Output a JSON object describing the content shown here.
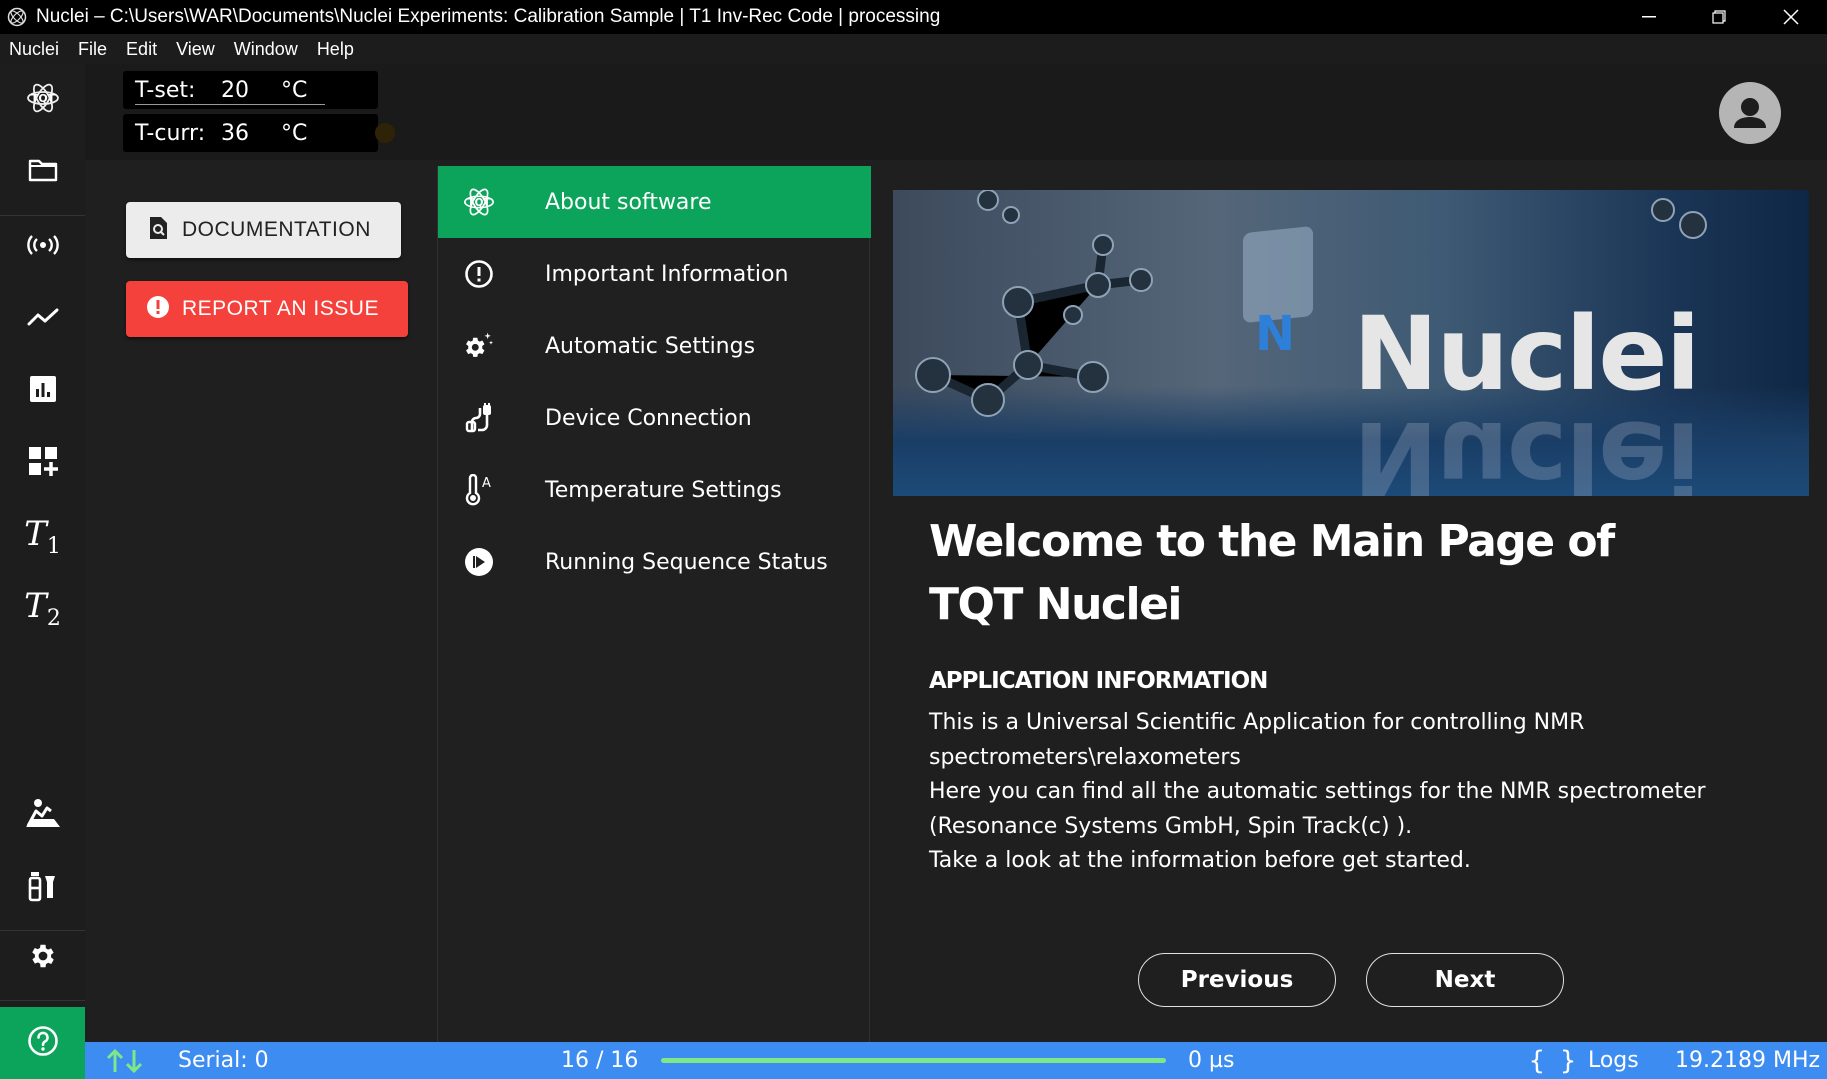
{
  "window": {
    "title": "Nuclei – C:\\Users\\WAR\\Documents\\Nuclei Experiments: Calibration Sample | T1 Inv-Rec Code | processing"
  },
  "menu": [
    "Nuclei",
    "File",
    "Edit",
    "View",
    "Window",
    "Help"
  ],
  "rail": {
    "items": [
      "tqt-logo-icon",
      "folder-icon",
      "signal-icon",
      "trend-icon",
      "bar-chart-icon",
      "add-widget-icon",
      "t1-icon",
      "t2-icon",
      "sample-icon",
      "lab-icon",
      "gear-icon",
      "cart-icon",
      "help-icon"
    ],
    "t1_symbol": "T",
    "t1_sub": "1",
    "t2_symbol": "T",
    "t2_sub": "2"
  },
  "header": {
    "t_set": {
      "label": "T-set:",
      "value": "20",
      "unit": "°C"
    },
    "t_curr": {
      "label": "T-curr:",
      "value": "36",
      "unit": "°C"
    }
  },
  "actions": {
    "documentation": "DOCUMENTATION",
    "report": "REPORT AN ISSUE"
  },
  "nav": {
    "items": [
      {
        "label": "About software",
        "icon": "tqt-logo-icon",
        "active": true
      },
      {
        "label": "Important Information",
        "icon": "alert-circle-icon",
        "active": false
      },
      {
        "label": "Automatic Settings",
        "icon": "auto-settings-icon",
        "active": false
      },
      {
        "label": "Device Connection",
        "icon": "plug-icon",
        "active": false
      },
      {
        "label": "Temperature Settings",
        "icon": "thermometer-icon",
        "active": false
      },
      {
        "label": "Running Sequence Status",
        "icon": "play-circle-icon",
        "active": false
      }
    ]
  },
  "content": {
    "hero_brand": "Nuclei",
    "welcome": "Welcome to the Main Page of TQT Nuclei",
    "app_info_heading": "APPLICATION INFORMATION",
    "app_info_lines": [
      "This is a Universal Scientific Application for controlling NMR",
      "spectrometers\\relaxometers",
      "Here you can find all the automatic settings for the NMR spectrometer",
      "(Resonance Systems GmbH, Spin Track(c) ).",
      "Take a look at the information before get started."
    ],
    "previous": "Previous",
    "next": "Next"
  },
  "status": {
    "serial": "Serial: 0",
    "progress_text": "16 / 16",
    "progress_fraction": 1.0,
    "time": "0 µs",
    "logs": "Logs",
    "frequency": "19.2189 MHz"
  },
  "colors": {
    "accent_green": "#0ca35a",
    "report_red": "#f5413b",
    "status_blue": "#3c8cf2",
    "progress_green": "#7ee787"
  }
}
